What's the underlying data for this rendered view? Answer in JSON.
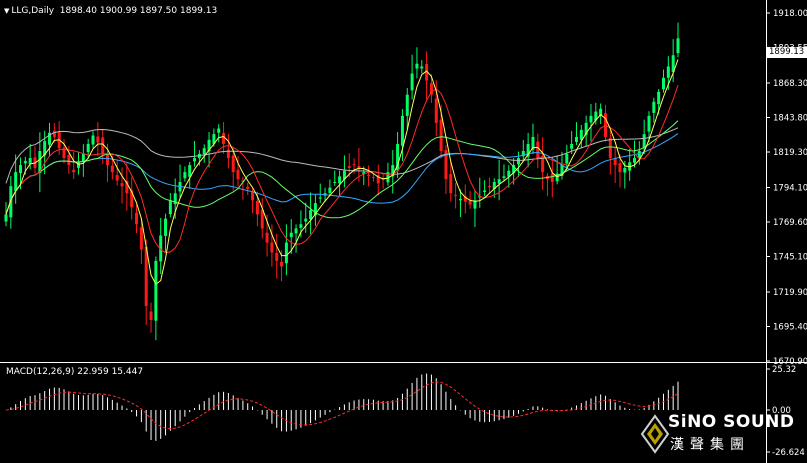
{
  "header": {
    "symbol": "LLG,Daily",
    "ohlc": "1898.40 1900.99 1897.50 1899.13"
  },
  "current_price_tag": "1899.13",
  "price_axis": [
    "1918.00",
    "1893.55",
    "1868.30",
    "1843.80",
    "1819.30",
    "1794.10",
    "1769.60",
    "1745.10",
    "1719.90",
    "1695.40",
    "1670.90"
  ],
  "macd": {
    "title": "MACD(12,26,9) 22.959 15.447",
    "axis": [
      "25.32",
      "0.00",
      "-26.624"
    ]
  },
  "logo": {
    "brand": "SiNO SOUND",
    "chinese": "漢聲集團"
  },
  "colors": {
    "background": "#000000",
    "bull_candle": "#00ff66",
    "bear_candle": "#ff1a1a",
    "ma_fast": "#ffff55",
    "ma_short": "#ff2a2a",
    "ma_mid": "#66ff66",
    "ma_cyan": "#33a8ff",
    "ma_long": "#bbbbbb",
    "macd_hist": "#ffffff",
    "macd_signal": "#ff2a2a"
  },
  "chart_data": {
    "type": "candlestick",
    "symbol": "LLG",
    "timeframe": "Daily",
    "ylim": [
      1670.9,
      1918.0
    ],
    "closes": [
      1775,
      1795,
      1805,
      1810,
      1813,
      1815,
      1808,
      1820,
      1827,
      1833,
      1830,
      1822,
      1815,
      1810,
      1805,
      1812,
      1818,
      1825,
      1831,
      1826,
      1818,
      1810,
      1805,
      1799,
      1795,
      1790,
      1780,
      1768,
      1750,
      1710,
      1700,
      1742,
      1760,
      1772,
      1785,
      1790,
      1798,
      1805,
      1810,
      1815,
      1818,
      1822,
      1828,
      1832,
      1836,
      1825,
      1815,
      1805,
      1800,
      1798,
      1793,
      1785,
      1775,
      1765,
      1755,
      1748,
      1742,
      1738,
      1755,
      1762,
      1765,
      1768,
      1772,
      1778,
      1783,
      1787,
      1790,
      1794,
      1798,
      1802,
      1806,
      1808,
      1810,
      1807,
      1805,
      1803,
      1801,
      1797,
      1800,
      1805,
      1810,
      1825,
      1845,
      1860,
      1875,
      1882,
      1880,
      1870,
      1860,
      1840,
      1820,
      1800,
      1790,
      1788,
      1786,
      1784,
      1782,
      1785,
      1788,
      1792,
      1795,
      1798,
      1800,
      1802,
      1806,
      1810,
      1815,
      1820,
      1825,
      1830,
      1815,
      1805,
      1800,
      1798,
      1804,
      1810,
      1818,
      1825,
      1830,
      1835,
      1840,
      1845,
      1848,
      1850,
      1830,
      1815,
      1810,
      1805,
      1808,
      1812,
      1815,
      1820,
      1832,
      1845,
      1855,
      1862,
      1872,
      1880,
      1888,
      1900
    ],
    "macd_histogram_range": [
      -26.624,
      25.32
    ]
  }
}
